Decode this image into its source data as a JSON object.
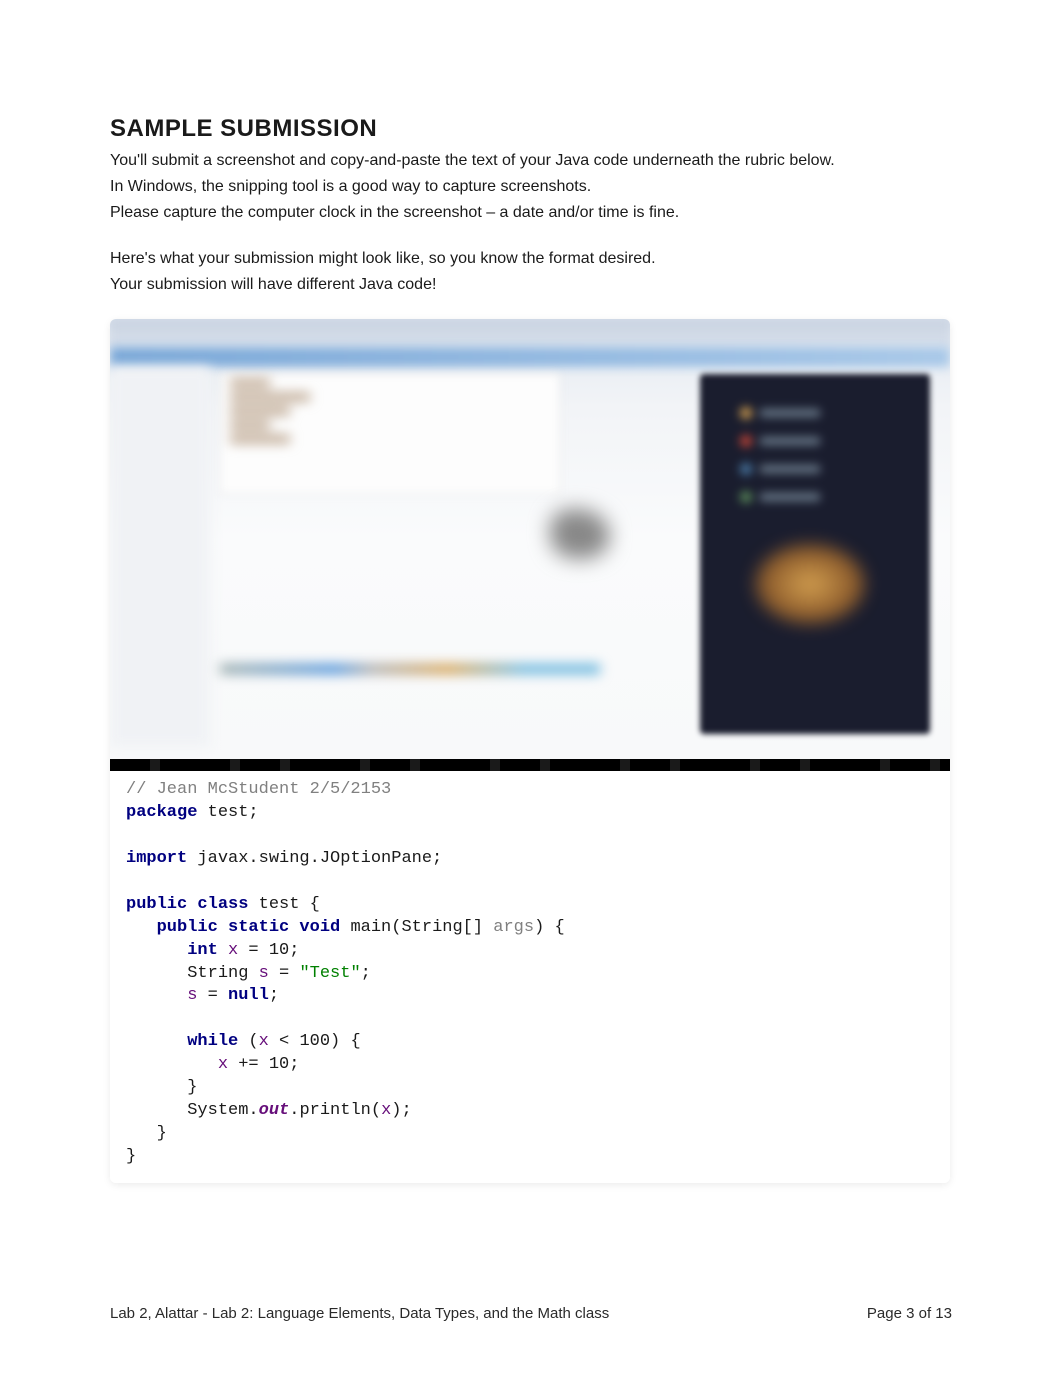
{
  "heading": "SAMPLE SUBMISSION",
  "intro": {
    "line1": "You'll submit a screenshot and copy-and-paste the text of your Java code underneath the rubric below.",
    "line2": "In Windows, the snipping tool is a good way to capture screenshots.",
    "line3": "Please capture the computer clock in the screenshot – a date and/or time is fine.",
    "line4": "Here's what your submission might look like, so you know the format desired.",
    "line5": "Your submission will have different Java code!"
  },
  "code": {
    "l01_comment": "// Jean McStudent 2/5/2153",
    "l02_kw": "package",
    "l02_rest": " test;",
    "l03": "",
    "l04_kw": "import",
    "l04_rest": " javax.swing.JOptionPane;",
    "l05": "",
    "l06_kw1": "public class",
    "l06_rest": " test {",
    "l07_indent": "   ",
    "l07_kw": "public static void",
    "l07_method": " main(String[] ",
    "l07_param": "args",
    "l07_end": ") {",
    "l08_indent": "      ",
    "l08_kw": "int",
    "l08_sp": " ",
    "l08_var": "x",
    "l08_rest": " = 10;",
    "l09_indent": "      ",
    "l09_type": "String ",
    "l09_var": "s",
    "l09_eq": " = ",
    "l09_str": "\"Test\"",
    "l09_semi": ";",
    "l10_indent": "      ",
    "l10_var": "s",
    "l10_eq": " = ",
    "l10_kw": "null",
    "l10_semi": ";",
    "l11": "",
    "l12_indent": "      ",
    "l12_kw": "while",
    "l12_open": " (",
    "l12_var": "x",
    "l12_rest": " < 100) {",
    "l13_indent": "         ",
    "l13_var": "x",
    "l13_rest": " += 10;",
    "l14_indent": "      ",
    "l14_brace": "}",
    "l15_indent": "      ",
    "l15_sys": "System.",
    "l15_out": "out",
    "l15_print": ".println(",
    "l15_var": "x",
    "l15_end": ");",
    "l16_indent": "   ",
    "l16_brace": "}",
    "l17_brace": "}"
  },
  "footer": {
    "left": "Lab 2, Alattar - Lab 2: Language Elements, Data Types, and the Math class",
    "right": "Page 3 of 13"
  }
}
